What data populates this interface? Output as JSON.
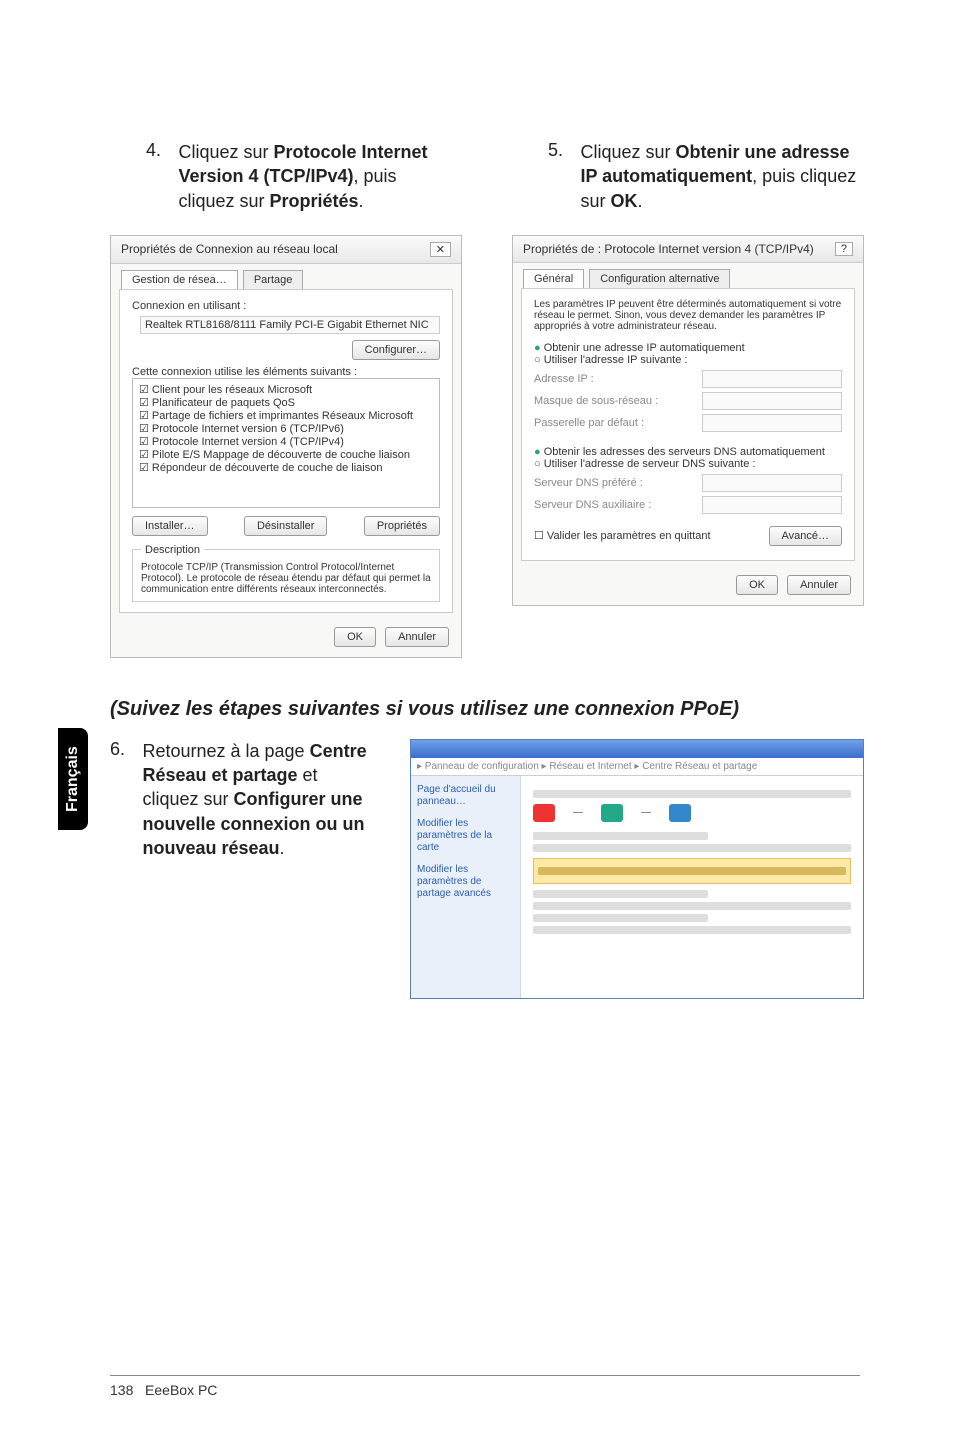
{
  "sidebar_tab": "Français",
  "step4": {
    "num": "4.",
    "pre": "Cliquez sur ",
    "b1": "Protocole Internet Version 4 (TCP/IPv4)",
    "mid": ", puis cliquez sur ",
    "b2": "Propriétés",
    "post": "."
  },
  "step5": {
    "num": "5.",
    "pre": "Cliquez sur ",
    "b1": "Obtenir une adresse IP automatiquement",
    "mid": ", puis cliquez sur ",
    "b2": "OK",
    "post": "."
  },
  "section_title": "(Suivez les étapes suivantes si vous utilisez une connexion PPoE)",
  "step6": {
    "num": "6.",
    "pre": "Retournez à la page ",
    "b1": "Centre Réseau et partage",
    "mid": " et cliquez sur ",
    "b2": "Configurer une nouvelle connexion ou un nouveau réseau",
    "post": "."
  },
  "dialog1": {
    "title": "Propriétés de Connexion au réseau local",
    "tab1": "Gestion de résea…",
    "tab2": "Partage",
    "conn_label": "Connexion en utilisant :",
    "adapter": "Realtek RTL8168/8111 Family PCI-E Gigabit Ethernet NIC",
    "configure": "Configurer…",
    "list_caption": "Cette connexion utilise les éléments suivants :",
    "items": [
      "Client pour les réseaux Microsoft",
      "Planificateur de paquets QoS",
      "Partage de fichiers et imprimantes Réseaux Microsoft",
      "Protocole Internet version 6 (TCP/IPv6)",
      "Protocole Internet version 4 (TCP/IPv4)",
      "Pilote E/S Mappage de découverte de couche liaison",
      "Répondeur de découverte de couche de liaison"
    ],
    "install": "Installer…",
    "uninstall": "Désinstaller",
    "properties": "Propriétés",
    "desc_legend": "Description",
    "desc_text": "Protocole TCP/IP (Transmission Control Protocol/Internet Protocol). Le protocole de réseau étendu par défaut qui permet la communication entre différents réseaux interconnectés.",
    "ok": "OK",
    "cancel": "Annuler",
    "close_glyph": "✕"
  },
  "dialog2": {
    "title": "Propriétés de : Protocole Internet version 4 (TCP/IPv4)",
    "tab1": "Général",
    "tab2": "Configuration alternative",
    "intro": "Les paramètres IP peuvent être déterminés automatiquement si votre réseau le permet. Sinon, vous devez demander les paramètres IP appropriés à votre administrateur réseau.",
    "r1": "Obtenir une adresse IP automatiquement",
    "r2": "Utiliser l'adresse IP suivante :",
    "ip": "Adresse IP :",
    "mask": "Masque de sous-réseau :",
    "gw": "Passerelle par défaut :",
    "r3": "Obtenir les adresses des serveurs DNS automatiquement",
    "r4": "Utiliser l'adresse de serveur DNS suivante :",
    "dns1": "Serveur DNS préféré :",
    "dns2": "Serveur DNS auxiliaire :",
    "validate": "Valider les paramètres en quittant",
    "advanced": "Avancé…",
    "ok": "OK",
    "cancel": "Annuler"
  },
  "footer": {
    "page": "138",
    "product": "EeeBox PC"
  }
}
